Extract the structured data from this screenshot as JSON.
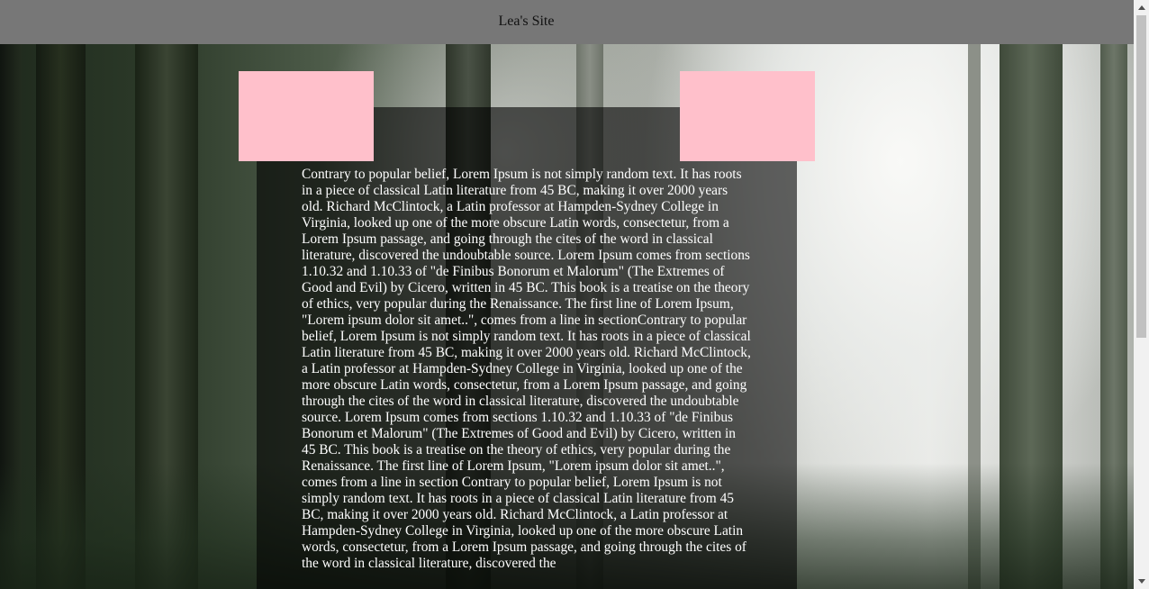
{
  "header": {
    "site_title": "Lea's Site"
  },
  "colors": {
    "header_bg": "#777777",
    "placeholder_box": "#ffc0cb",
    "panel_bg": "rgba(0,0,0,0.6)",
    "article_text": "#ffffff"
  },
  "background": {
    "icon": "forest-photo"
  },
  "main": {
    "article_text": "Contrary to popular belief, Lorem Ipsum is not simply random text. It has roots in a piece of classical Latin literature from 45 BC, making it over 2000 years old. Richard McClintock, a Latin professor at Hampden-Sydney College in Virginia, looked up one of the more obscure Latin words, consectetur, from a Lorem Ipsum passage, and going through the cites of the word in classical literature, discovered the undoubtable source. Lorem Ipsum comes from sections 1.10.32 and 1.10.33 of \"de Finibus Bonorum et Malorum\" (The Extremes of Good and Evil) by Cicero, written in 45 BC. This book is a treatise on the theory of ethics, very popular during the Renaissance. The first line of Lorem Ipsum, \"Lorem ipsum dolor sit amet..\", comes from a line in sectionContrary to popular belief, Lorem Ipsum is not simply random text. It has roots in a piece of classical Latin literature from 45 BC, making it over 2000 years old. Richard McClintock, a Latin professor at Hampden-Sydney College in Virginia, looked up one of the more obscure Latin words, consectetur, from a Lorem Ipsum passage, and going through the cites of the word in classical literature, discovered the undoubtable source. Lorem Ipsum comes from sections 1.10.32 and 1.10.33 of \"de Finibus Bonorum et Malorum\" (The Extremes of Good and Evil) by Cicero, written in 45 BC. This book is a treatise on the theory of ethics, very popular during the Renaissance. The first line of Lorem Ipsum, \"Lorem ipsum dolor sit amet..\", comes from a line in section Contrary to popular belief, Lorem Ipsum is not simply random text. It has roots in a piece of classical Latin literature from 45 BC, making it over 2000 years old. Richard McClintock, a Latin professor at Hampden-Sydney College in Virginia, looked up one of the more obscure Latin words, consectetur, from a Lorem Ipsum passage, and going through the cites of the word in classical literature, discovered the"
  }
}
